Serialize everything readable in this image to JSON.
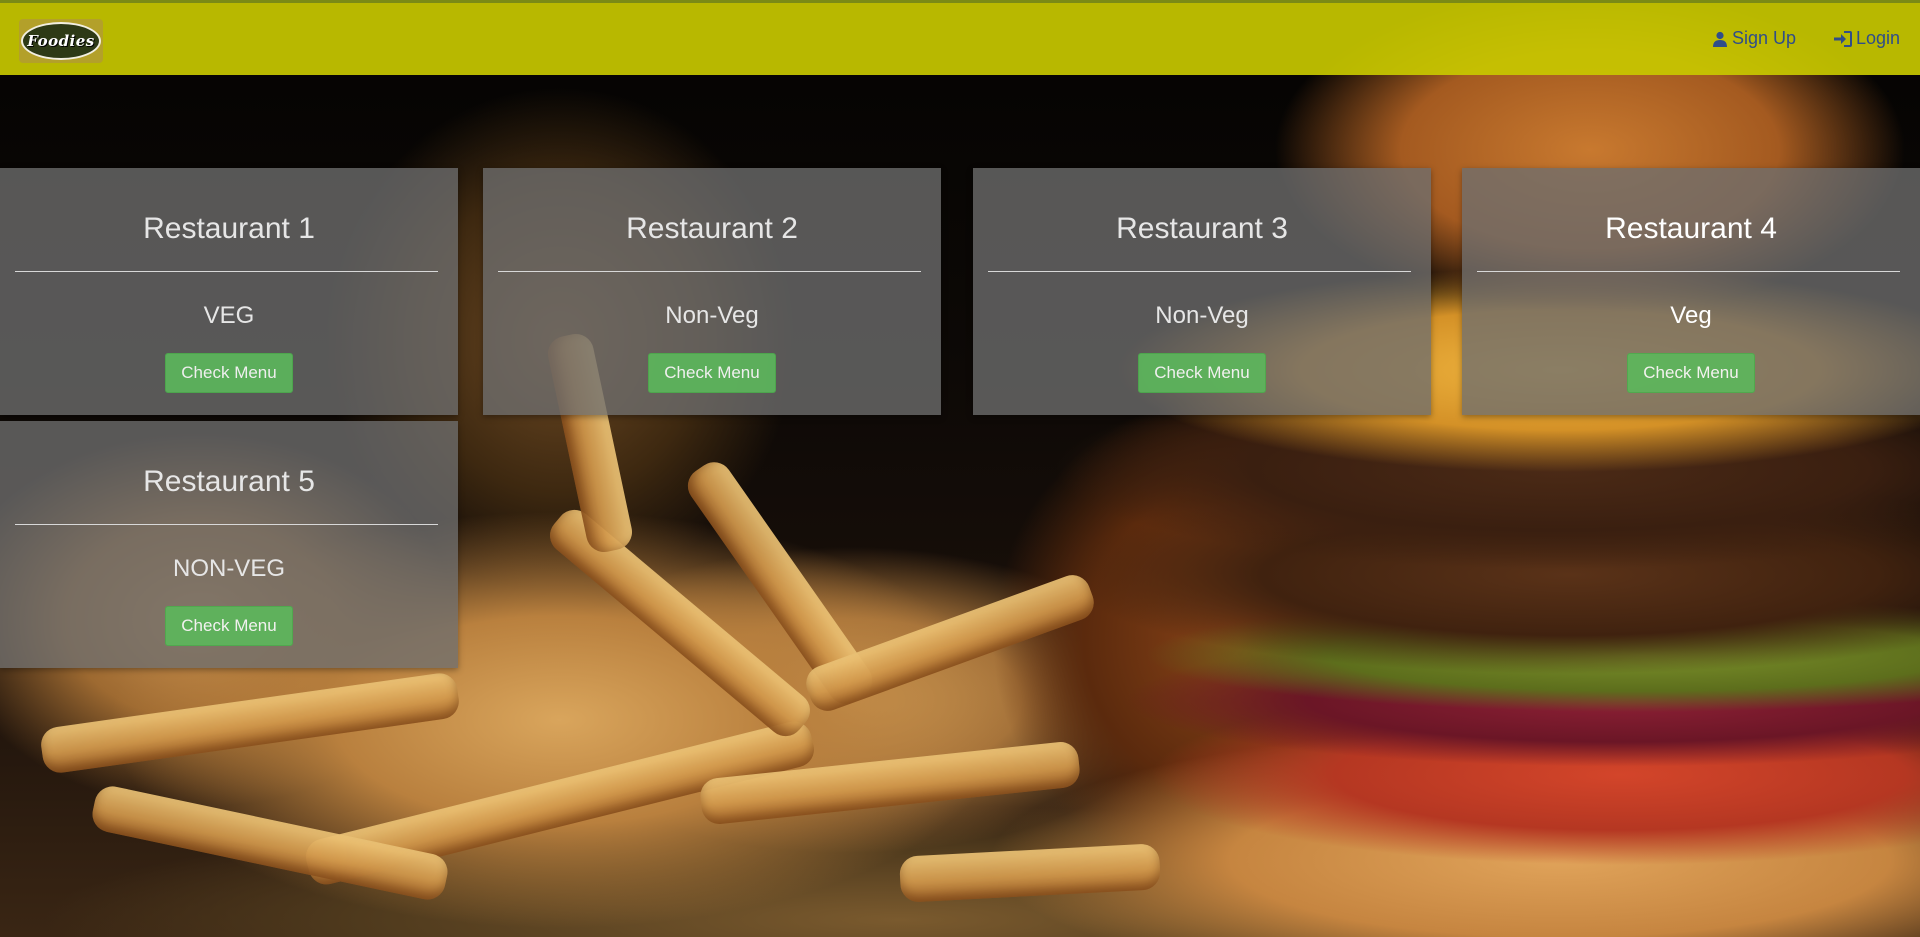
{
  "header": {
    "logo_text": "Foodies",
    "nav": {
      "signup_label": "Sign Up",
      "login_label": "Login"
    }
  },
  "restaurants": [
    {
      "name": "Restaurant 1",
      "type": "VEG",
      "button_label": "Check Menu"
    },
    {
      "name": "Restaurant 2",
      "type": "Non-Veg",
      "button_label": "Check Menu"
    },
    {
      "name": "Restaurant 3",
      "type": "Non-Veg",
      "button_label": "Check Menu"
    },
    {
      "name": "Restaurant 4",
      "type": "Veg",
      "button_label": "Check Menu"
    },
    {
      "name": "Restaurant 5",
      "type": "NON-VEG",
      "button_label": "Check Menu"
    }
  ],
  "colors": {
    "topbar": "#c8c800",
    "card_bg": "#6e6e6e",
    "button": "#5cb85c",
    "nav_link": "#2f4d8a"
  },
  "icons": {
    "signup": "user-icon",
    "login": "sign-in-icon"
  }
}
